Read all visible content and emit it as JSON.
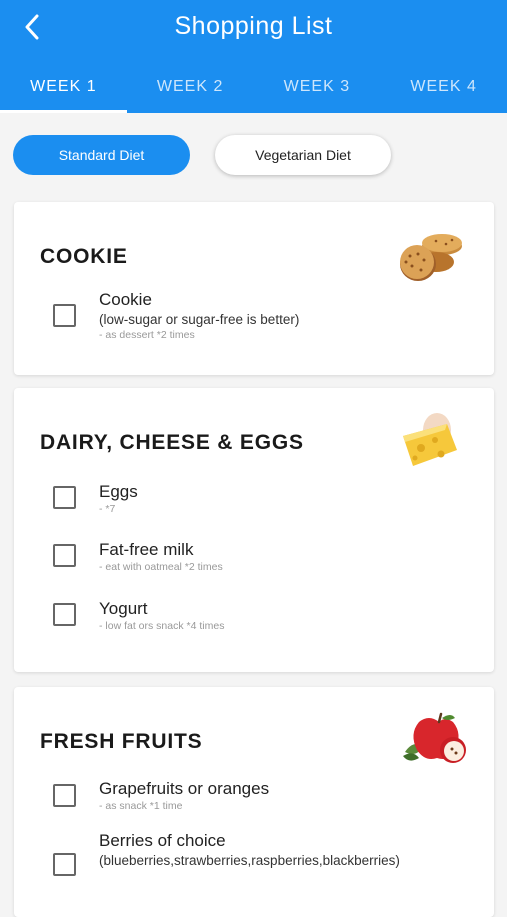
{
  "header": {
    "title": "Shopping List",
    "back_icon": "chevron-left-icon",
    "tabs": [
      {
        "label": "WEEK 1",
        "active": true
      },
      {
        "label": "WEEK 2",
        "active": false
      },
      {
        "label": "WEEK 3",
        "active": false
      },
      {
        "label": "WEEK 4",
        "active": false
      }
    ]
  },
  "diet_toggle": {
    "standard_label": "Standard Diet",
    "vegetarian_label": "Vegetarian Diet",
    "selected": "Standard Diet"
  },
  "sections": [
    {
      "title": "COOKIE",
      "image": "cookies-illustration",
      "items": [
        {
          "name": "Cookie",
          "detail": "(low-sugar or sugar-free is better)",
          "note": "- as dessert *2 times",
          "checked": false
        }
      ]
    },
    {
      "title": "DAIRY, CHEESE & EGGS",
      "image": "cheese-egg-illustration",
      "items": [
        {
          "name": "Eggs",
          "note": "- *7",
          "checked": false
        },
        {
          "name": "Fat-free milk",
          "note": "- eat with oatmeal *2 times",
          "checked": false
        },
        {
          "name": "Yogurt",
          "note": "- low fat ors snack *4 times",
          "checked": false
        }
      ]
    },
    {
      "title": "FRESH FRUITS",
      "image": "apple-illustration",
      "items": [
        {
          "name": "Grapefruits or oranges",
          "note": "- as snack *1 time",
          "checked": false
        },
        {
          "name": "Berries of choice",
          "detail": "(blueberries,strawberries,raspberries,blackberries)",
          "checked": false
        }
      ]
    }
  ],
  "colors": {
    "primary": "#1b8ef0",
    "background": "#f4f4f4",
    "card": "#ffffff"
  }
}
